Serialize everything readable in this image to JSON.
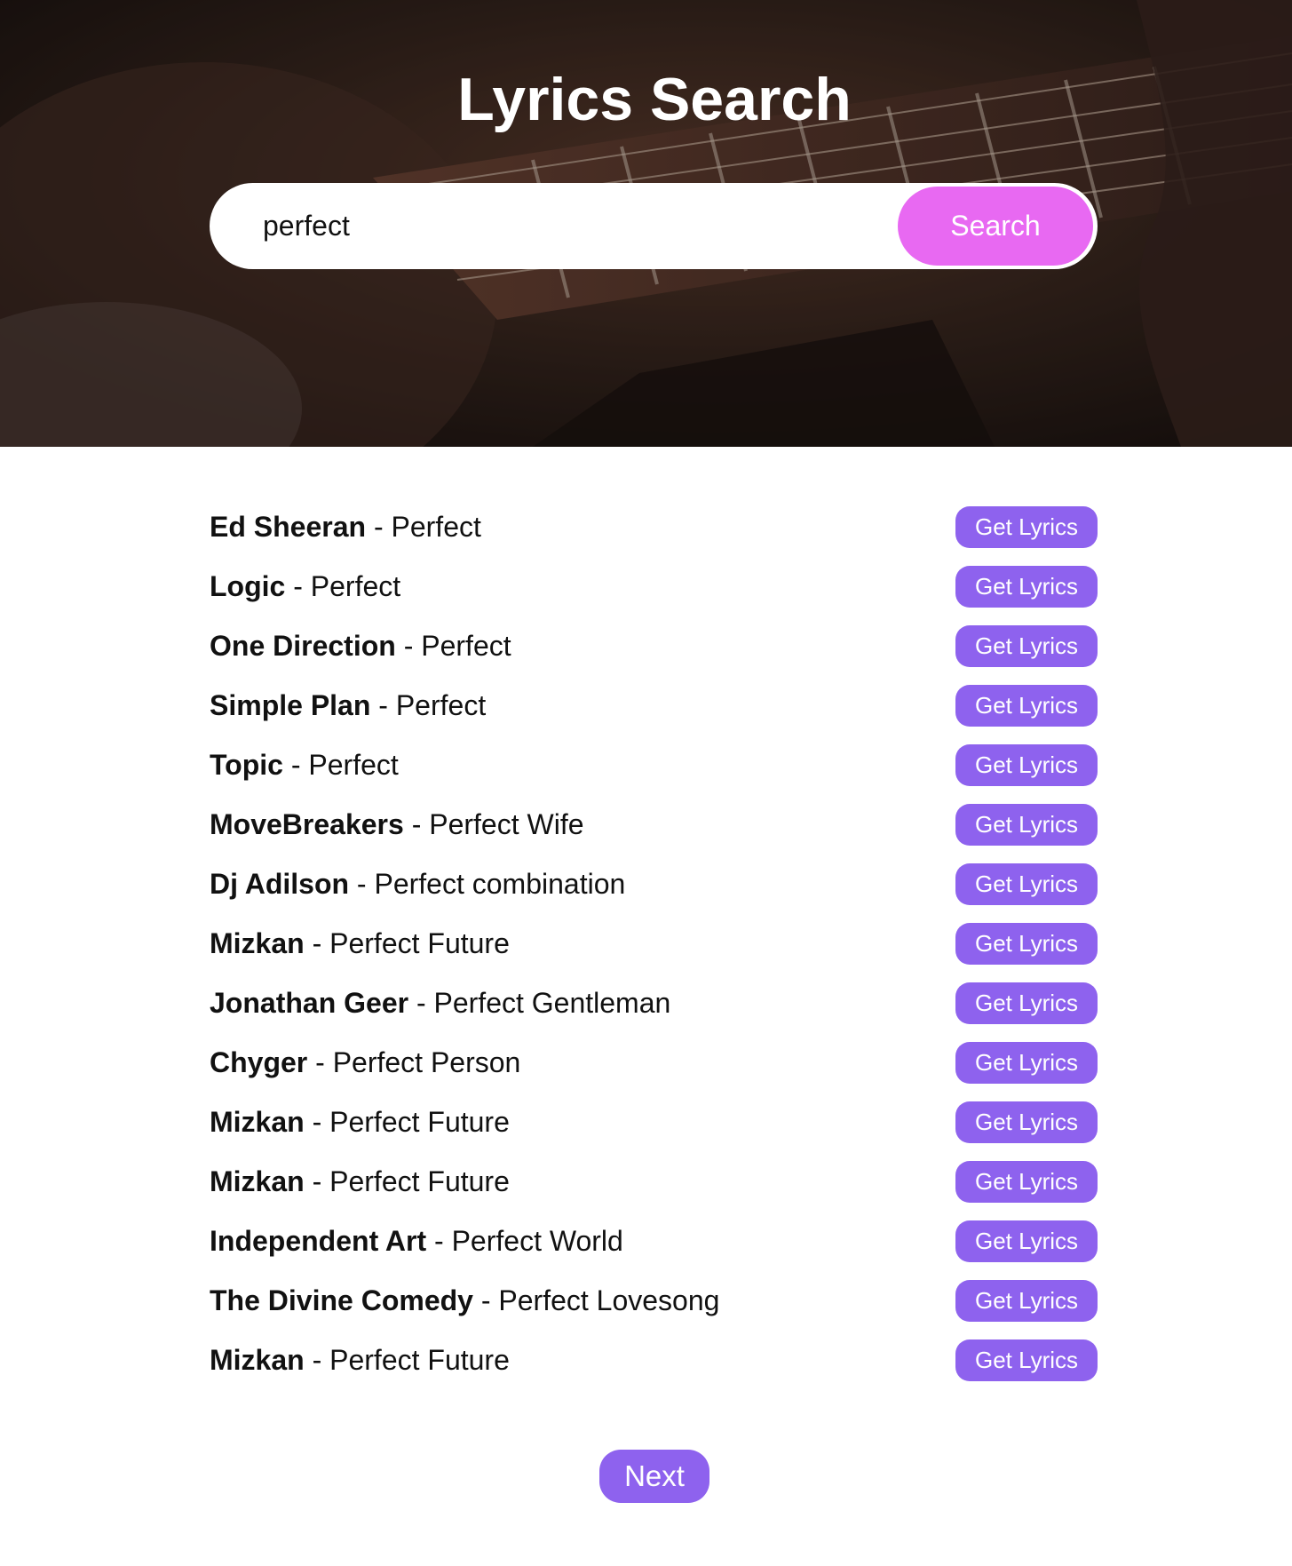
{
  "header": {
    "title": "Lyrics Search"
  },
  "search": {
    "value": "perfect",
    "placeholder": "",
    "button_label": "Search"
  },
  "results": [
    {
      "artist": "Ed Sheeran",
      "separator": " - ",
      "title": "Perfect",
      "button_label": "Get Lyrics"
    },
    {
      "artist": "Logic",
      "separator": " - ",
      "title": "Perfect",
      "button_label": "Get Lyrics"
    },
    {
      "artist": "One Direction",
      "separator": " - ",
      "title": "Perfect",
      "button_label": "Get Lyrics"
    },
    {
      "artist": "Simple Plan",
      "separator": " - ",
      "title": "Perfect",
      "button_label": "Get Lyrics"
    },
    {
      "artist": "Topic",
      "separator": " - ",
      "title": "Perfect",
      "button_label": "Get Lyrics"
    },
    {
      "artist": "MoveBreakers",
      "separator": " - ",
      "title": "Perfect Wife",
      "button_label": "Get Lyrics"
    },
    {
      "artist": "Dj Adilson",
      "separator": " - ",
      "title": "Perfect combination",
      "button_label": "Get Lyrics"
    },
    {
      "artist": "Mizkan",
      "separator": " - ",
      "title": "Perfect Future",
      "button_label": "Get Lyrics"
    },
    {
      "artist": "Jonathan Geer",
      "separator": " - ",
      "title": "Perfect Gentleman",
      "button_label": "Get Lyrics"
    },
    {
      "artist": "Chyger",
      "separator": " - ",
      "title": "Perfect Person",
      "button_label": "Get Lyrics"
    },
    {
      "artist": "Mizkan",
      "separator": " - ",
      "title": "Perfect Future",
      "button_label": "Get Lyrics"
    },
    {
      "artist": "Mizkan",
      "separator": " - ",
      "title": "Perfect Future",
      "button_label": "Get Lyrics"
    },
    {
      "artist": "Independent Art",
      "separator": " - ",
      "title": "Perfect World",
      "button_label": "Get Lyrics"
    },
    {
      "artist": "The Divine Comedy",
      "separator": " - ",
      "title": "Perfect Lovesong",
      "button_label": "Get Lyrics"
    },
    {
      "artist": "Mizkan",
      "separator": " - ",
      "title": "Perfect Future",
      "button_label": "Get Lyrics"
    }
  ],
  "pagination": {
    "next_label": "Next"
  },
  "colors": {
    "search_button": "#e869f2",
    "accent_purple": "#8e62ee",
    "hero_dark": "#2a1d18"
  }
}
